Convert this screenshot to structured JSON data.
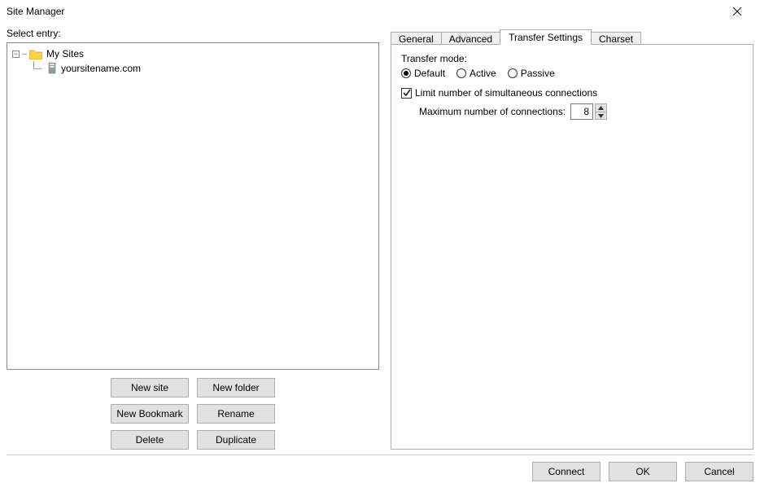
{
  "window": {
    "title": "Site Manager"
  },
  "left_panel": {
    "select_entry_label": "Select entry:",
    "tree": {
      "root_label": "My Sites",
      "items": [
        {
          "label": "yoursitename.com"
        }
      ]
    },
    "buttons": {
      "new_site": "New site",
      "new_folder": "New folder",
      "new_bookmark": "New Bookmark",
      "rename": "Rename",
      "delete": "Delete",
      "duplicate": "Duplicate"
    }
  },
  "right_panel": {
    "tabs": {
      "general": "General",
      "advanced": "Advanced",
      "transfer_settings": "Transfer Settings",
      "charset": "Charset",
      "active_index": 2
    },
    "transfer_settings": {
      "mode_label": "Transfer mode:",
      "options": {
        "default": "Default",
        "active": "Active",
        "passive": "Passive",
        "selected": "default"
      },
      "limit_checkbox": {
        "label": "Limit number of simultaneous connections",
        "checked": true
      },
      "max_conn": {
        "label": "Maximum number of connections:",
        "value": "8"
      }
    }
  },
  "footer": {
    "connect": "Connect",
    "ok": "OK",
    "cancel": "Cancel"
  }
}
